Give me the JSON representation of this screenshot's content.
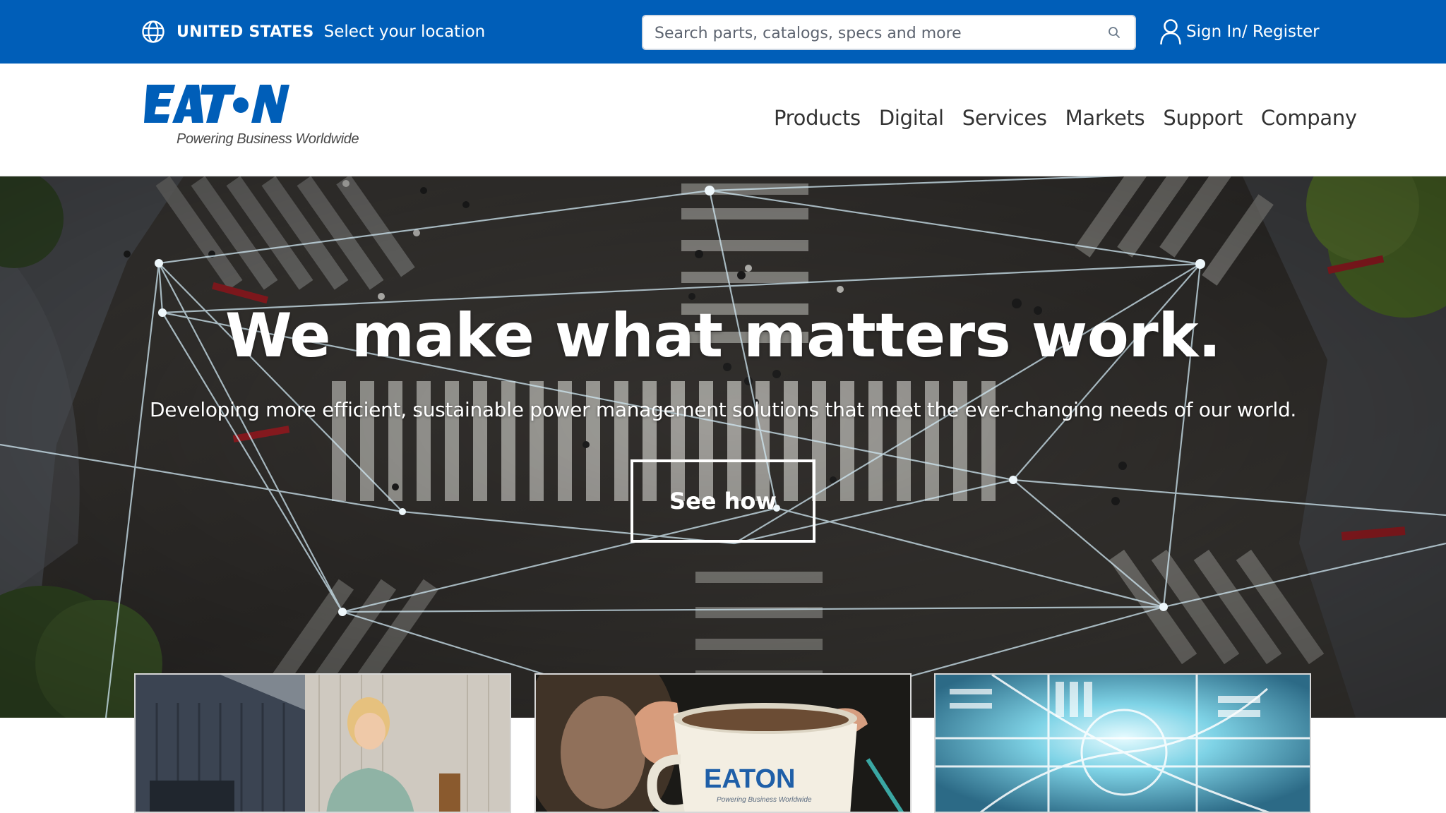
{
  "top_bar": {
    "country": "UNITED STATES",
    "location_link": "Select your location",
    "search_placeholder": "Search parts, catalogs, specs and more",
    "signin_label": "Sign In/ Register"
  },
  "header": {
    "logo_text": "EATON",
    "tagline": "Powering Business Worldwide",
    "nav": [
      "Products",
      "Digital",
      "Services",
      "Markets",
      "Support",
      "Company"
    ]
  },
  "hero": {
    "title": "We make what matters work.",
    "subtitle": "Developing more efficient, sustainable power management solutions that meet the ever-changing needs of our world.",
    "cta_label": "See how"
  },
  "cards": [
    {
      "image": "woman-outside-house"
    },
    {
      "image": "eaton-coffee-mug",
      "mug_logo": "EATON",
      "mug_tagline": "Powering Business Worldwide"
    },
    {
      "image": "aerial-intersection-blue"
    }
  ],
  "colors": {
    "brand_blue": "#005eb8",
    "nav_text": "#333333",
    "white": "#ffffff"
  },
  "icons": [
    "globe-icon",
    "search-icon",
    "user-icon"
  ]
}
